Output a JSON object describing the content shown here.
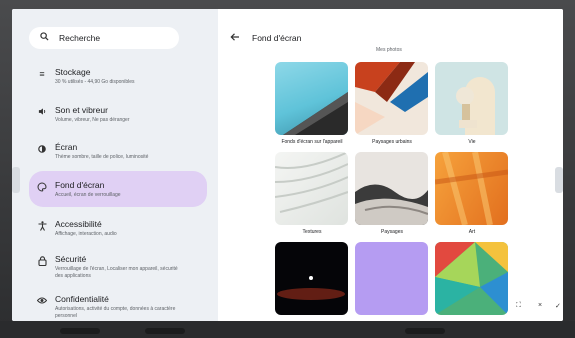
{
  "search": {
    "label": "Recherche"
  },
  "sidebar": {
    "items": [
      {
        "title": "Stockage",
        "subtitle": "30 % utilisés - 44,90 Go disponibles",
        "icon": "storage-icon",
        "glyph": "≡"
      },
      {
        "title": "Son et vibreur",
        "subtitle": "Volume, vibreur, Ne pas déranger",
        "icon": "volume-icon",
        "glyph": "🔉"
      },
      {
        "title": "Écran",
        "subtitle": "Thème sombre, taille de police, luminosité",
        "icon": "brightness-icon",
        "glyph": "◐"
      },
      {
        "title": "Fond d'écran",
        "subtitle": "Accueil, écran de verrouillage",
        "icon": "palette-icon",
        "glyph": "◕"
      },
      {
        "title": "Accessibilité",
        "subtitle": "Affichage, interaction, audio",
        "icon": "accessibility-icon",
        "glyph": "✝"
      },
      {
        "title": "Sécurité",
        "subtitle": "Verrouillage de l'écran, Localiser mon appareil, sécurité des applications",
        "icon": "lock-icon",
        "glyph": "🔒"
      },
      {
        "title": "Confidentialité",
        "subtitle": "Autorisations, activité du compte, données à caractère personnel",
        "icon": "privacy-icon",
        "glyph": "◉"
      }
    ]
  },
  "content": {
    "title": "Fond d'écran",
    "clipped_label": "Mes photos",
    "categories": [
      {
        "label": "Fonds d'écran sur l'appareil"
      },
      {
        "label": "Paysages urbains"
      },
      {
        "label": "Vie"
      },
      {
        "label": "Textures"
      },
      {
        "label": "Paysages"
      },
      {
        "label": "Art"
      }
    ]
  },
  "overlay": {
    "expand": "⛶",
    "close": "×",
    "confirm": "✓"
  },
  "colors": {
    "accent": "#e0d0f4",
    "sidebar_bg": "#edf0f4"
  }
}
